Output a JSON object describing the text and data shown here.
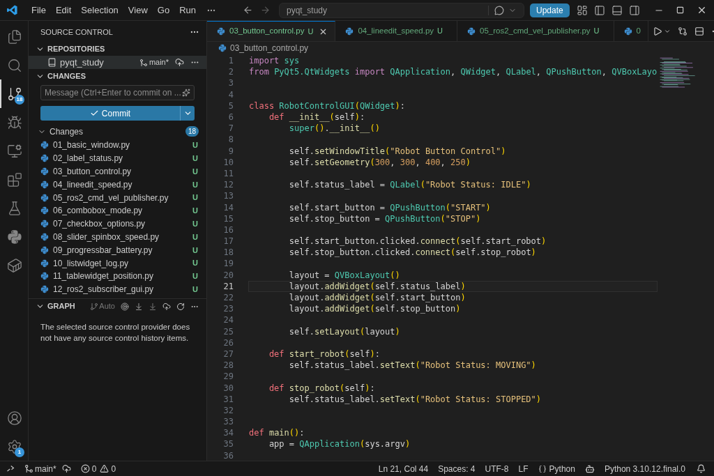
{
  "menu": [
    "File",
    "Edit",
    "Selection",
    "View",
    "Go",
    "Run"
  ],
  "command_center": {
    "value": "pyqt_study"
  },
  "update_button": "Update",
  "activity_bar": {
    "items": [
      {
        "kind": "files",
        "selected": false
      },
      {
        "kind": "search",
        "selected": false
      },
      {
        "kind": "scm",
        "selected": true,
        "badge": "18"
      },
      {
        "kind": "debug",
        "selected": false
      },
      {
        "kind": "remote",
        "selected": false
      },
      {
        "kind": "extensions",
        "selected": false
      },
      {
        "kind": "testing",
        "selected": false
      },
      {
        "kind": "python",
        "selected": false
      },
      {
        "kind": "container",
        "selected": false
      }
    ],
    "bottom": [
      {
        "kind": "account"
      },
      {
        "kind": "settings",
        "badge": "1"
      }
    ]
  },
  "sidebar": {
    "title": "SOURCE CONTROL",
    "repositories_header": "REPOSITORIES",
    "repository": {
      "name": "pyqt_study",
      "branch": "main*"
    },
    "changes_header": "CHANGES",
    "message": {
      "placeholder": "Message (Ctrl+Enter to commit on ..."
    },
    "commit_button": "Commit",
    "changes_group": {
      "label": "Changes",
      "count": "18"
    },
    "files": [
      {
        "name": "01_basic_window.py",
        "status": "U"
      },
      {
        "name": "02_label_status.py",
        "status": "U"
      },
      {
        "name": "03_button_control.py",
        "status": "U"
      },
      {
        "name": "04_lineedit_speed.py",
        "status": "U"
      },
      {
        "name": "05_ros2_cmd_vel_publisher.py",
        "status": "U"
      },
      {
        "name": "06_combobox_mode.py",
        "status": "U"
      },
      {
        "name": "07_checkbox_options.py",
        "status": "U"
      },
      {
        "name": "08_slider_spinbox_speed.py",
        "status": "U"
      },
      {
        "name": "09_progressbar_battery.py",
        "status": "U"
      },
      {
        "name": "10_listwidget_log.py",
        "status": "U"
      },
      {
        "name": "11_tablewidget_position.py",
        "status": "U"
      },
      {
        "name": "12_ros2_subscriber_gui.py",
        "status": "U"
      }
    ],
    "graph": {
      "header": "GRAPH",
      "auto": "Auto",
      "message": "The selected source control provider does not have any source control history items."
    }
  },
  "tabs": [
    {
      "label": "03_button_control.py",
      "status": "U",
      "selected": true
    },
    {
      "label": "04_lineedit_speed.py",
      "status": "U",
      "selected": false
    },
    {
      "label": "05_ros2_cmd_vel_publisher.py",
      "status": "U",
      "selected": false
    },
    {
      "label": "0",
      "selected": false
    }
  ],
  "breadcrumb": "03_button_control.py",
  "code": [
    {
      "n": "1",
      "current": false,
      "tokens": [
        {
          "s": "import",
          "kind": "kw"
        },
        {
          "s": " sys",
          "kind": "type"
        }
      ]
    },
    {
      "n": "2",
      "current": false,
      "tokens": [
        {
          "s": "from",
          "kind": "kw"
        },
        {
          "s": " PyQt5.QtWidgets ",
          "kind": "type"
        },
        {
          "s": "import",
          "kind": "kw"
        },
        {
          "s": " QApplication",
          "kind": "type"
        },
        {
          "s": ", ",
          "kind": "text"
        },
        {
          "s": "QWidget",
          "kind": "type"
        },
        {
          "s": ", ",
          "kind": "text"
        },
        {
          "s": "QLabel",
          "kind": "type"
        },
        {
          "s": ", ",
          "kind": "text"
        },
        {
          "s": "QPushButton",
          "kind": "type"
        },
        {
          "s": ", ",
          "kind": "text"
        },
        {
          "s": "QVBoxLayo",
          "kind": "type"
        }
      ]
    },
    {
      "n": "3",
      "current": false
    },
    {
      "n": "4",
      "current": false
    },
    {
      "n": "5",
      "current": false,
      "tokens": [
        {
          "s": "class",
          "kind": "decl"
        },
        {
          "s": " RobotControlGUI",
          "kind": "type"
        },
        {
          "s": "(",
          "kind": "punct"
        },
        {
          "s": "QWidget",
          "kind": "type"
        },
        {
          "s": ")",
          "kind": "punct"
        },
        {
          "s": ":",
          "kind": "text"
        }
      ]
    },
    {
      "n": "6",
      "current": false,
      "tokens": [
        {
          "s": "    def",
          "kind": "decl"
        },
        {
          "s": " __init__",
          "kind": "fn"
        },
        {
          "s": "(",
          "kind": "punct"
        },
        {
          "s": "self",
          "kind": "text"
        },
        {
          "s": ")",
          "kind": "punct"
        },
        {
          "s": ":",
          "kind": "text"
        }
      ]
    },
    {
      "n": "7",
      "current": false,
      "tokens": [
        {
          "s": "        super",
          "kind": "type"
        },
        {
          "s": "()",
          "kind": "punct"
        },
        {
          "s": ".",
          "kind": "text"
        },
        {
          "s": "__init__",
          "kind": "fn"
        },
        {
          "s": "()",
          "kind": "punct"
        }
      ]
    },
    {
      "n": "8",
      "current": false
    },
    {
      "n": "9",
      "current": false,
      "tokens": [
        {
          "s": "        self.",
          "kind": "text"
        },
        {
          "s": "setWindowTitle",
          "kind": "fn"
        },
        {
          "s": "(",
          "kind": "punct"
        },
        {
          "s": "\"Robot Button Control\"",
          "kind": "str"
        },
        {
          "s": ")",
          "kind": "punct"
        }
      ]
    },
    {
      "n": "10",
      "current": false,
      "tokens": [
        {
          "s": "        self.",
          "kind": "text"
        },
        {
          "s": "setGeometry",
          "kind": "fn"
        },
        {
          "s": "(",
          "kind": "punct"
        },
        {
          "s": "300",
          "kind": "num"
        },
        {
          "s": ", ",
          "kind": "text"
        },
        {
          "s": "300",
          "kind": "num"
        },
        {
          "s": ", ",
          "kind": "text"
        },
        {
          "s": "400",
          "kind": "num"
        },
        {
          "s": ", ",
          "kind": "text"
        },
        {
          "s": "250",
          "kind": "num"
        },
        {
          "s": ")",
          "kind": "punct"
        }
      ]
    },
    {
      "n": "11",
      "current": false
    },
    {
      "n": "12",
      "current": false,
      "tokens": [
        {
          "s": "        self.status_label = ",
          "kind": "text"
        },
        {
          "s": "QLabel",
          "kind": "type"
        },
        {
          "s": "(",
          "kind": "punct"
        },
        {
          "s": "\"Robot Status: IDLE\"",
          "kind": "str"
        },
        {
          "s": ")",
          "kind": "punct"
        }
      ]
    },
    {
      "n": "13",
      "current": false
    },
    {
      "n": "14",
      "current": false,
      "tokens": [
        {
          "s": "        self.start_button = ",
          "kind": "text"
        },
        {
          "s": "QPushButton",
          "kind": "type"
        },
        {
          "s": "(",
          "kind": "punct"
        },
        {
          "s": "\"START\"",
          "kind": "str"
        },
        {
          "s": ")",
          "kind": "punct"
        }
      ]
    },
    {
      "n": "15",
      "current": false,
      "tokens": [
        {
          "s": "        self.stop_button = ",
          "kind": "text"
        },
        {
          "s": "QPushButton",
          "kind": "type"
        },
        {
          "s": "(",
          "kind": "punct"
        },
        {
          "s": "\"STOP\"",
          "kind": "str"
        },
        {
          "s": ")",
          "kind": "punct"
        }
      ]
    },
    {
      "n": "16",
      "current": false
    },
    {
      "n": "17",
      "current": false,
      "tokens": [
        {
          "s": "        self.start_button.clicked.",
          "kind": "text"
        },
        {
          "s": "connect",
          "kind": "fn"
        },
        {
          "s": "(",
          "kind": "punct"
        },
        {
          "s": "self.start_robot",
          "kind": "text"
        },
        {
          "s": ")",
          "kind": "punct"
        }
      ]
    },
    {
      "n": "18",
      "current": false,
      "tokens": [
        {
          "s": "        self.stop_button.clicked.",
          "kind": "text"
        },
        {
          "s": "connect",
          "kind": "fn"
        },
        {
          "s": "(",
          "kind": "punct"
        },
        {
          "s": "self.stop_robot",
          "kind": "text"
        },
        {
          "s": ")",
          "kind": "punct"
        }
      ]
    },
    {
      "n": "19",
      "current": false
    },
    {
      "n": "20",
      "current": false,
      "tokens": [
        {
          "s": "        layout = ",
          "kind": "text"
        },
        {
          "s": "QVBoxLayout",
          "kind": "type"
        },
        {
          "s": "()",
          "kind": "punct"
        }
      ]
    },
    {
      "n": "21",
      "current": true,
      "tokens": [
        {
          "s": "        layout.",
          "kind": "text"
        },
        {
          "s": "addWidget",
          "kind": "fn"
        },
        {
          "s": "(",
          "kind": "punct"
        },
        {
          "s": "self.status_label",
          "kind": "text"
        },
        {
          "s": ")",
          "kind": "punct"
        }
      ]
    },
    {
      "n": "22",
      "current": false,
      "tokens": [
        {
          "s": "        layout.",
          "kind": "text"
        },
        {
          "s": "addWidget",
          "kind": "fn"
        },
        {
          "s": "(",
          "kind": "punct"
        },
        {
          "s": "self.start_button",
          "kind": "text"
        },
        {
          "s": ")",
          "kind": "punct"
        }
      ]
    },
    {
      "n": "23",
      "current": false,
      "tokens": [
        {
          "s": "        layout.",
          "kind": "text"
        },
        {
          "s": "addWidget",
          "kind": "fn"
        },
        {
          "s": "(",
          "kind": "punct"
        },
        {
          "s": "self.stop_button",
          "kind": "text"
        },
        {
          "s": ")",
          "kind": "punct"
        }
      ]
    },
    {
      "n": "24",
      "current": false
    },
    {
      "n": "25",
      "current": false,
      "tokens": [
        {
          "s": "        self.",
          "kind": "text"
        },
        {
          "s": "setLayout",
          "kind": "fn"
        },
        {
          "s": "(",
          "kind": "punct"
        },
        {
          "s": "layout",
          "kind": "text"
        },
        {
          "s": ")",
          "kind": "punct"
        }
      ]
    },
    {
      "n": "26",
      "current": false
    },
    {
      "n": "27",
      "current": false,
      "tokens": [
        {
          "s": "    def",
          "kind": "decl"
        },
        {
          "s": " start_robot",
          "kind": "fn"
        },
        {
          "s": "(",
          "kind": "punct"
        },
        {
          "s": "self",
          "kind": "text"
        },
        {
          "s": ")",
          "kind": "punct"
        },
        {
          "s": ":",
          "kind": "text"
        }
      ]
    },
    {
      "n": "28",
      "current": false,
      "tokens": [
        {
          "s": "        self.status_label.",
          "kind": "text"
        },
        {
          "s": "setText",
          "kind": "fn"
        },
        {
          "s": "(",
          "kind": "punct"
        },
        {
          "s": "\"Robot Status: MOVING\"",
          "kind": "str"
        },
        {
          "s": ")",
          "kind": "punct"
        }
      ]
    },
    {
      "n": "29",
      "current": false
    },
    {
      "n": "30",
      "current": false,
      "tokens": [
        {
          "s": "    def",
          "kind": "decl"
        },
        {
          "s": " stop_robot",
          "kind": "fn"
        },
        {
          "s": "(",
          "kind": "punct"
        },
        {
          "s": "self",
          "kind": "text"
        },
        {
          "s": ")",
          "kind": "punct"
        },
        {
          "s": ":",
          "kind": "text"
        }
      ]
    },
    {
      "n": "31",
      "current": false,
      "tokens": [
        {
          "s": "        self.status_label.",
          "kind": "text"
        },
        {
          "s": "setText",
          "kind": "fn"
        },
        {
          "s": "(",
          "kind": "punct"
        },
        {
          "s": "\"Robot Status: STOPPED\"",
          "kind": "str"
        },
        {
          "s": ")",
          "kind": "punct"
        }
      ]
    },
    {
      "n": "32",
      "current": false
    },
    {
      "n": "33",
      "current": false
    },
    {
      "n": "34",
      "current": false,
      "tokens": [
        {
          "s": "def",
          "kind": "decl"
        },
        {
          "s": " main",
          "kind": "fn"
        },
        {
          "s": "()",
          "kind": "punct"
        },
        {
          "s": ":",
          "kind": "text"
        }
      ]
    },
    {
      "n": "35",
      "current": false,
      "tokens": [
        {
          "s": "    app = ",
          "kind": "text"
        },
        {
          "s": "QApplication",
          "kind": "type"
        },
        {
          "s": "(",
          "kind": "punct"
        },
        {
          "s": "sys.argv",
          "kind": "text"
        },
        {
          "s": ")",
          "kind": "punct"
        }
      ]
    },
    {
      "n": "36",
      "current": false
    }
  ],
  "status_bar": {
    "branch": "main*",
    "errors": "0",
    "warnings": "0",
    "position": "Ln 21, Col 44",
    "indent": "Spaces: 4",
    "encoding": "UTF-8",
    "eol": "LF",
    "language": "Python",
    "interpreter": "Python 3.10.12.final.0"
  }
}
